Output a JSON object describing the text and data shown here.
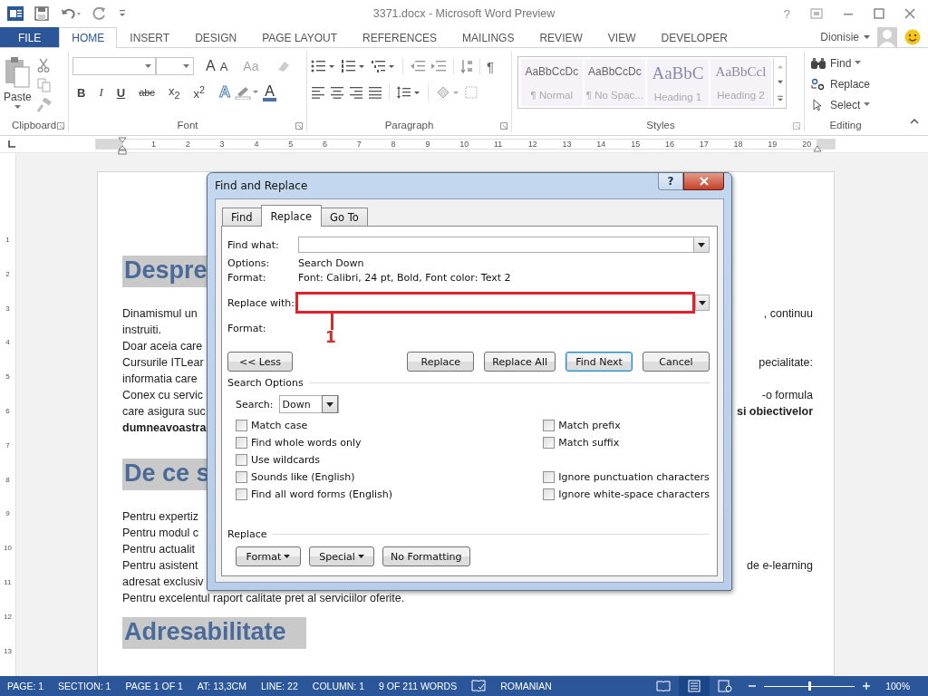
{
  "title_bar": {
    "title": "3371.docx - Microsoft Word Preview",
    "help": "?"
  },
  "ribbon_tabs": [
    {
      "label": "FILE",
      "kind": "file",
      "selected": false
    },
    {
      "label": "HOME",
      "kind": "tab",
      "selected": true
    },
    {
      "label": "INSERT",
      "kind": "tab",
      "selected": false
    },
    {
      "label": "DESIGN",
      "kind": "tab",
      "selected": false
    },
    {
      "label": "PAGE LAYOUT",
      "kind": "tab",
      "selected": false
    },
    {
      "label": "REFERENCES",
      "kind": "tab",
      "selected": false
    },
    {
      "label": "MAILINGS",
      "kind": "tab",
      "selected": false
    },
    {
      "label": "REVIEW",
      "kind": "tab",
      "selected": false
    },
    {
      "label": "VIEW",
      "kind": "tab",
      "selected": false
    },
    {
      "label": "DEVELOPER",
      "kind": "tab",
      "selected": false
    }
  ],
  "user": {
    "name": "Dionisie"
  },
  "clipboard": {
    "paste": "Paste",
    "label": "Clipboard"
  },
  "font": {
    "label": "Font",
    "size_buttons": [
      "A",
      "A",
      "Aa"
    ],
    "format_buttons": [
      {
        "text": "B",
        "kind": "bold"
      },
      {
        "text": "I",
        "kind": "italic"
      },
      {
        "text": "U",
        "kind": "underline"
      },
      {
        "text": "abc",
        "kind": "strike"
      },
      {
        "text": "x$_{2}$",
        "kind": "subscript"
      },
      {
        "text": "x$^{2}$",
        "kind": "superscript"
      }
    ],
    "effects_letter": "A",
    "color_letter": "A"
  },
  "paragraph": {
    "label": "Paragraph",
    "pilcrow": "¶"
  },
  "styles": {
    "label": "Styles",
    "items": [
      {
        "preview": "AaBbCcDc",
        "name": "¶ Normal",
        "kind": "body"
      },
      {
        "preview": "AaBbCcDc",
        "name": "¶ No Spac...",
        "kind": "body"
      },
      {
        "preview": "AaBbC",
        "name": "Heading 1",
        "kind": "h1"
      },
      {
        "preview": "AaBbCcl",
        "name": "Heading 2",
        "kind": "h2"
      }
    ]
  },
  "editing": {
    "label": "Editing",
    "items": [
      {
        "label": "Find",
        "kind": "find",
        "dropdown": true
      },
      {
        "label": "Replace",
        "kind": "replace",
        "dropdown": false
      },
      {
        "label": "Select",
        "kind": "select",
        "dropdown": true
      }
    ]
  },
  "ruler": [
    "1",
    "2",
    "3",
    "4",
    "5",
    "6",
    "7",
    "8",
    "9",
    "10",
    "11",
    "12",
    "13",
    "14",
    "15",
    "16",
    "17",
    "18",
    "19",
    "20"
  ],
  "vertical_ruler": [
    "1",
    "2",
    "3",
    "4",
    "5",
    "6",
    "7",
    "8",
    "9",
    "10",
    "11",
    "12",
    "13"
  ],
  "document": [
    {
      "kind": "heading",
      "text": "Despre"
    },
    {
      "kind": "line",
      "parts": [
        {
          "text": "Dinamismul un",
          "bold": false
        },
        {
          "text": ", continuu",
          "bold": false
        }
      ]
    },
    {
      "kind": "line",
      "parts": [
        {
          "text": "instruiti.",
          "bold": false
        }
      ]
    },
    {
      "kind": "line",
      "parts": [
        {
          "text": "Doar aceia care",
          "bold": false
        }
      ]
    },
    {
      "kind": "line",
      "parts": [
        {
          "text": "Cursurile ITLear",
          "bold": false
        },
        {
          "text": "pecialitate:",
          "bold": false
        }
      ]
    },
    {
      "kind": "line",
      "parts": [
        {
          "text": "informatia care",
          "bold": false
        }
      ]
    },
    {
      "kind": "line",
      "parts": [
        {
          "text": "Conex cu servic",
          "bold": false
        },
        {
          "text": "-o formula",
          "bold": false
        }
      ]
    },
    {
      "kind": "line",
      "parts": [
        {
          "text": "care asigura suc",
          "bold": false
        },
        {
          "text": "si obiectivelor",
          "bold": true
        }
      ]
    },
    {
      "kind": "line",
      "parts": [
        {
          "text": "dumneavoastra",
          "bold": true
        }
      ]
    },
    {
      "kind": "heading",
      "text": "De ce s"
    },
    {
      "kind": "line",
      "parts": [
        {
          "text": "Pentru expertiz",
          "bold": false
        }
      ]
    },
    {
      "kind": "line",
      "parts": [
        {
          "text": "Pentru modul c",
          "bold": false
        }
      ]
    },
    {
      "kind": "line",
      "parts": [
        {
          "text": "Pentru actualit",
          "bold": false
        }
      ]
    },
    {
      "kind": "line",
      "parts": [
        {
          "text": "Pentru asistent",
          "bold": false
        },
        {
          "text": "de e-learning",
          "bold": false
        }
      ]
    },
    {
      "kind": "line",
      "parts": [
        {
          "text": "adresat exclusiv",
          "bold": false
        }
      ]
    },
    {
      "kind": "line",
      "parts": [
        {
          "text": "Pentru excelentul raport calitate pret al serviciilor oferite.",
          "bold": false
        }
      ]
    },
    {
      "kind": "heading",
      "text": "Adresabilitate"
    }
  ],
  "dialog": {
    "title": "Find and Replace",
    "help": "?",
    "tabs": [
      {
        "label": "Find",
        "selected": false
      },
      {
        "label": "Replace",
        "selected": true
      },
      {
        "label": "Go To",
        "selected": false
      }
    ],
    "find_label": "Find what:",
    "info": [
      {
        "label": "Options:",
        "value": "Search Down"
      },
      {
        "label": "Format:",
        "value": "Font: Calibri, 24 pt, Bold, Font color: Text 2"
      }
    ],
    "replace_label": "Replace with:",
    "replace_format_label": "Format:",
    "less_button": "<< Less",
    "buttons": [
      {
        "label": "Replace",
        "default": false
      },
      {
        "label": "Replace All",
        "default": false
      },
      {
        "label": "Find Next",
        "default": true
      },
      {
        "label": "Cancel",
        "default": false
      }
    ],
    "search_options_title": "Search Options",
    "search_label": "Search:",
    "search_value": "Down",
    "left_options": [
      {
        "label": "Match case",
        "checked": false
      },
      {
        "label": "Find whole words only",
        "checked": false
      },
      {
        "label": "Use wildcards",
        "checked": false
      },
      {
        "label": "Sounds like (English)",
        "checked": false
      },
      {
        "label": "Find all word forms (English)",
        "checked": false
      }
    ],
    "right_groups": [
      [
        {
          "label": "Match prefix",
          "checked": false
        },
        {
          "label": "Match suffix",
          "checked": false
        }
      ],
      [
        {
          "label": "Ignore punctuation characters",
          "checked": false
        },
        {
          "label": "Ignore white-space characters",
          "checked": false
        }
      ]
    ],
    "replace_title": "Replace",
    "replace_buttons": [
      {
        "label": "Format",
        "dropdown": true
      },
      {
        "label": "Special",
        "dropdown": true
      },
      {
        "label": "No Formatting",
        "dropdown": false
      }
    ]
  },
  "annotation": {
    "label": "1"
  },
  "status_bar": {
    "items": [
      "PAGE: 1",
      "SECTION: 1",
      "PAGE 1 OF 1",
      "AT: 13,3CM",
      "LINE: 22",
      "COLUMN: 1",
      "9 OF 211 WORDS"
    ],
    "language": "ROMANIAN",
    "views": [
      {
        "kind": "read",
        "selected": false
      },
      {
        "kind": "print",
        "selected": true
      },
      {
        "kind": "web",
        "selected": false
      }
    ],
    "zoom_slider": {
      "level": 0.5
    },
    "zoom": "100%"
  }
}
